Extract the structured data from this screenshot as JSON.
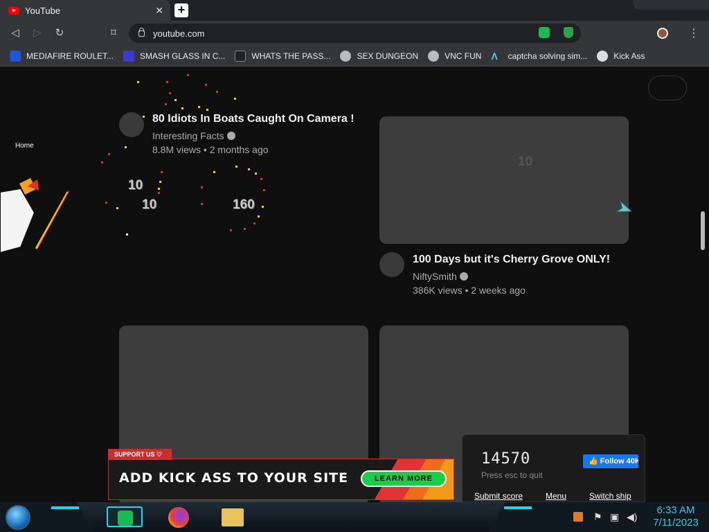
{
  "browser": {
    "tab_title": "YouTube",
    "tab_close": "✕",
    "new_tab": "+",
    "url": "youtube.com",
    "menu": "⋮"
  },
  "bookmarks": [
    {
      "label": "MEDIAFIRE ROULET...",
      "icon": "mediafire-icon",
      "color": "#1a56d6"
    },
    {
      "label": "SMASH GLASS IN C...",
      "icon": "chevron-icon",
      "color": "#3b3bd0"
    },
    {
      "label": "WHATS THE PASS...",
      "icon": "terminal-icon",
      "color": "#222222"
    },
    {
      "label": "SEX DUNGEON",
      "icon": "cube-icon",
      "color": "#bbbbbb"
    },
    {
      "label": "VNC FUN",
      "icon": "cube-icon",
      "color": "#bbbbbb"
    },
    {
      "label": "captcha solving sim...",
      "icon": "lambda-icon",
      "color": "#4fd0e0"
    },
    {
      "label": "Kick Ass",
      "icon": "globe-icon",
      "color": "#dddddd"
    }
  ],
  "youtube": {
    "home_label": "Home",
    "videos": [
      {
        "title": "80 Idiots In Boats Caught On Camera !",
        "channel": "Interesting Facts",
        "meta": "8.8M views • 2 months ago"
      },
      {
        "title": "100 Days but it's Cherry Grove ONLY!",
        "channel": "NiftySmith",
        "meta": "386K views • 2 weeks ago"
      }
    ]
  },
  "game": {
    "hit_points": [
      "10",
      "10",
      "160",
      "10"
    ],
    "score": "14570",
    "esc_hint": "Press esc to quit",
    "follow_label": "Follow 40K",
    "submit_score": "Submit score",
    "menu": "Menu",
    "switch_ship": "Switch ship",
    "banner_tag": "SUPPORT US ♡",
    "banner_text": "ADD KICK ASS TO YOUR SITE",
    "learn_more": "LEARN MORE"
  },
  "taskbar": {
    "time": "6:33 AM",
    "date": "7/11/2023"
  },
  "colors": {
    "accent": "#1dd8e6",
    "banner_red": "#cf2d2d",
    "learn_green": "#1ccd4c",
    "yt_red": "#ff0000"
  }
}
